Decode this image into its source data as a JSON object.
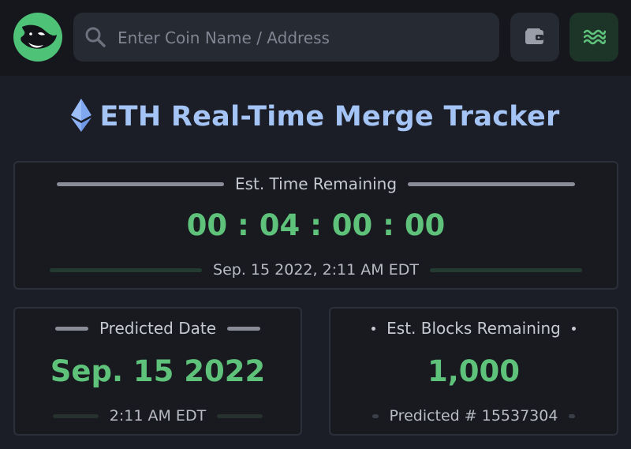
{
  "header": {
    "search": {
      "placeholder": "Enter Coin Name / Address",
      "value": ""
    }
  },
  "page": {
    "title": "ETH Real-Time Merge Tracker"
  },
  "countdown": {
    "label": "Est. Time Remaining",
    "value": "00 : 04 : 00 : 00",
    "date": "Sep. 15 2022, 2:11 AM EDT"
  },
  "predicted": {
    "label": "Predicted Date",
    "value": "Sep. 15 2022",
    "time": "2:11 AM EDT"
  },
  "blocks": {
    "label": "Est. Blocks Remaining",
    "value": "1,000",
    "predicted": "Predicted # 15537304"
  },
  "colors": {
    "accent_green": "#5ec27a",
    "title_blue": "#a5c4f6",
    "logo_green": "#4ec276",
    "background": "#1b1e26"
  },
  "icons": {
    "logo": "orca-logo",
    "search": "search-icon",
    "wallet": "wallet-icon",
    "menu": "waves-menu-icon",
    "title": "ethereum-icon"
  }
}
